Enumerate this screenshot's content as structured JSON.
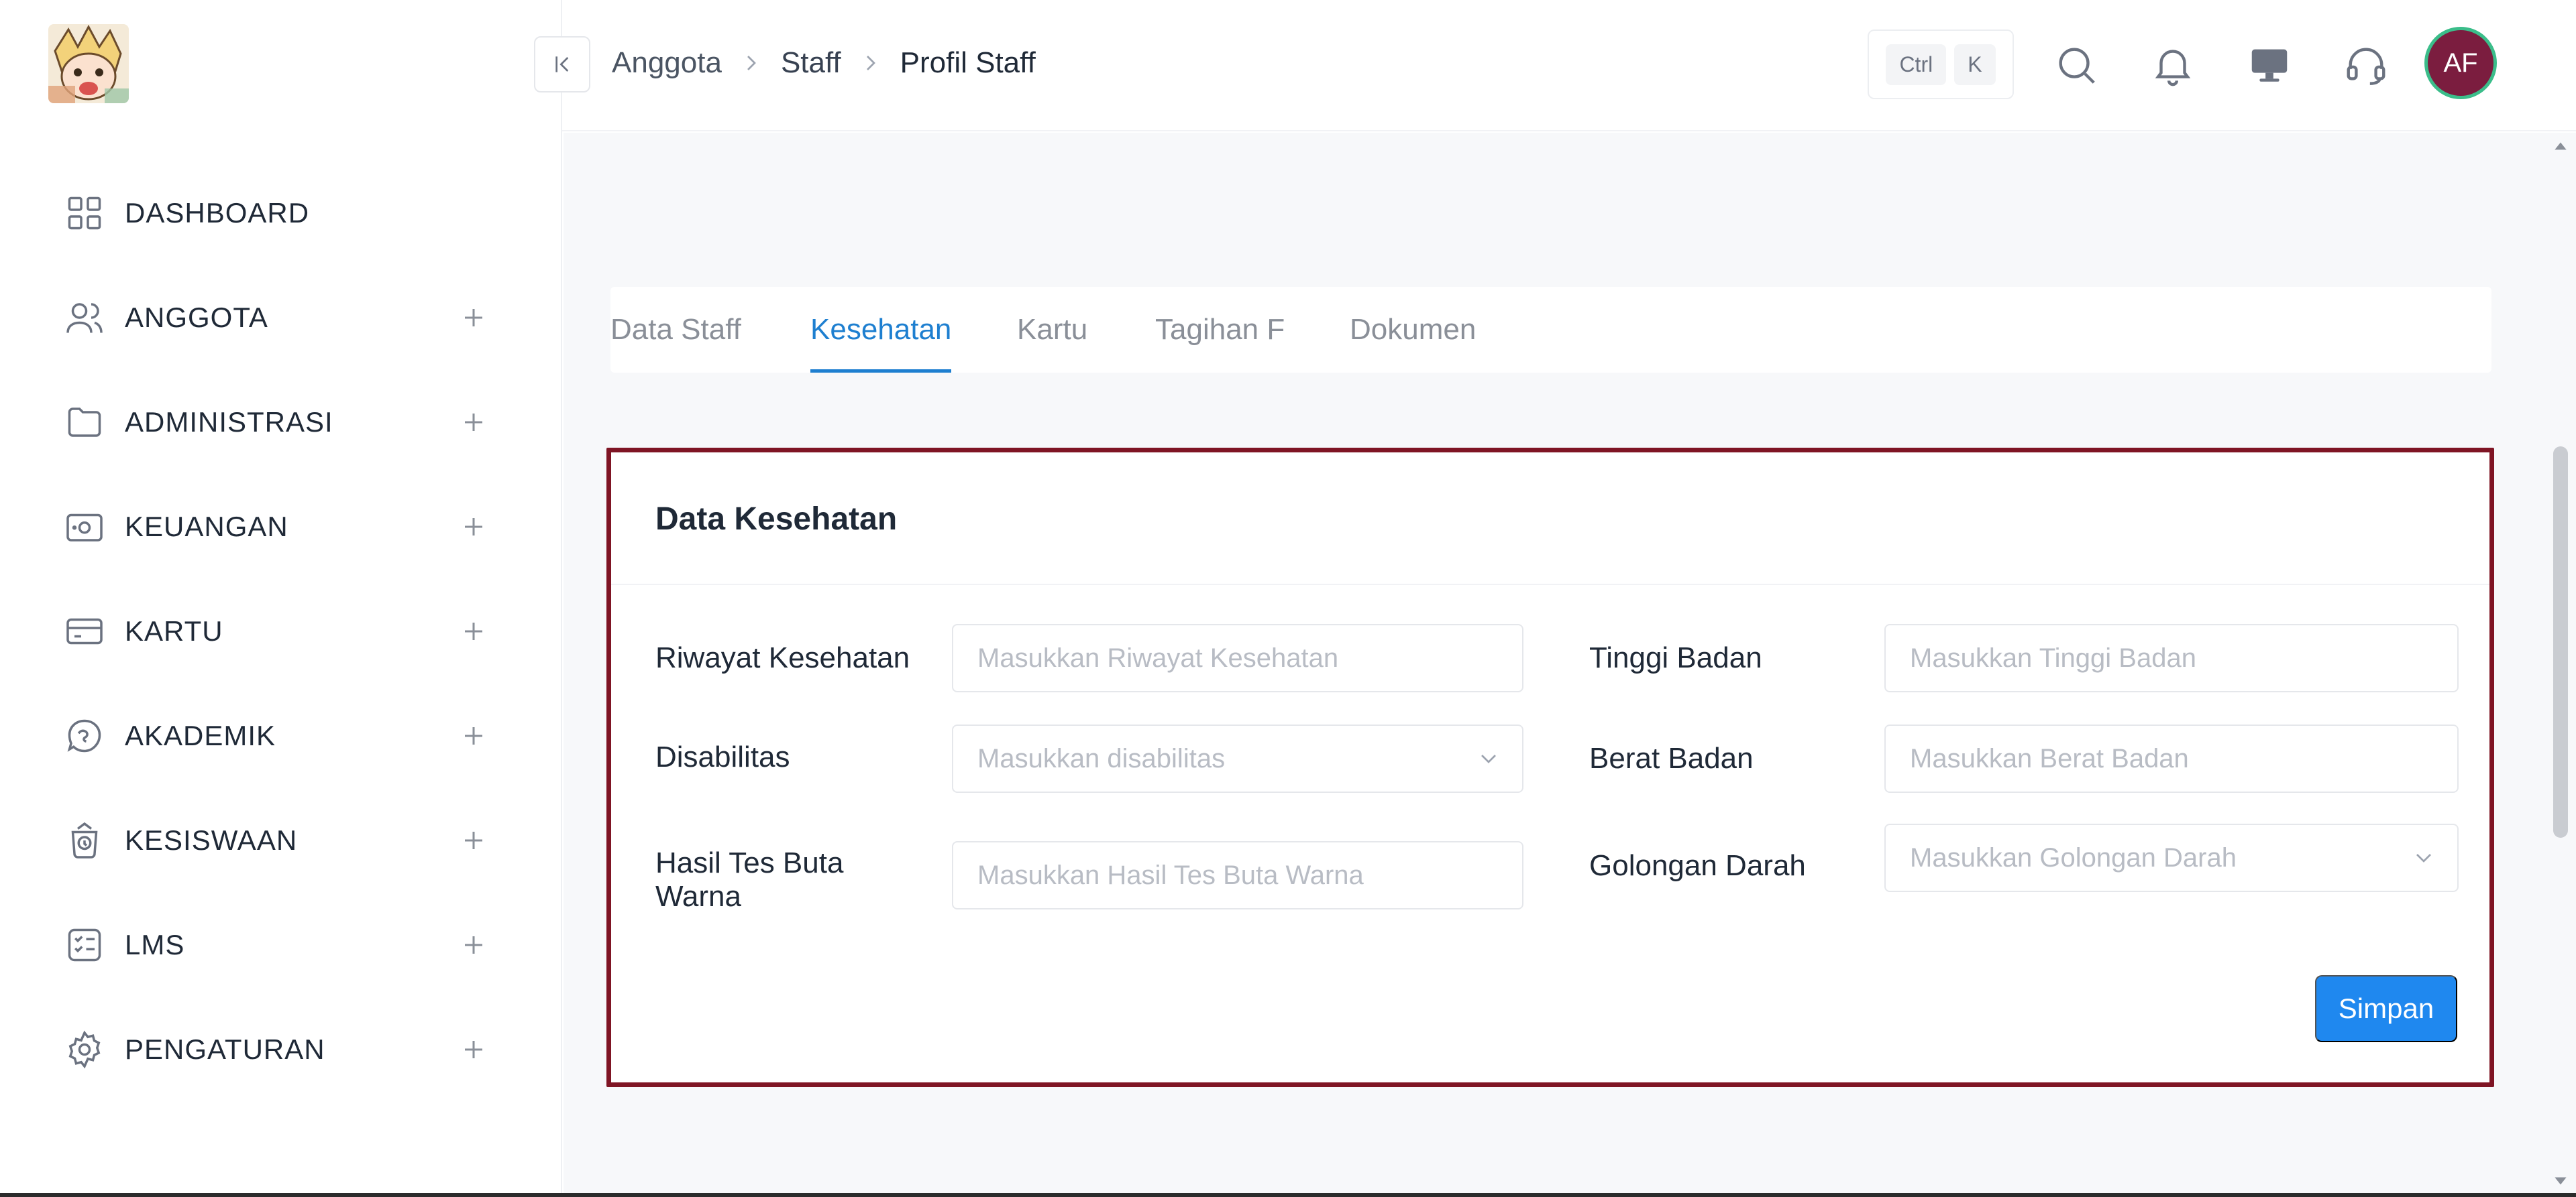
{
  "colors": {
    "accent": "#1e7fd0",
    "primary_button": "#1f88ef",
    "highlight_border": "#7f1524",
    "avatar_bg": "#7b1d3f",
    "avatar_ring": "#3bbd8a"
  },
  "sidebar": {
    "logo_icon": "anime-avatar-logo",
    "items": [
      {
        "label": "DASHBOARD",
        "icon": "grid-icon",
        "expandable": false
      },
      {
        "label": "ANGGOTA",
        "icon": "users-icon",
        "expandable": true
      },
      {
        "label": "ADMINISTRASI",
        "icon": "folder-icon",
        "expandable": true
      },
      {
        "label": "KEUANGAN",
        "icon": "wallet-icon",
        "expandable": true
      },
      {
        "label": "KARTU",
        "icon": "card-icon",
        "expandable": true
      },
      {
        "label": "AKADEMIK",
        "icon": "academic-icon",
        "expandable": true
      },
      {
        "label": "KESISWAAN",
        "icon": "student-icon",
        "expandable": true
      },
      {
        "label": "LMS",
        "icon": "checklist-icon",
        "expandable": true
      },
      {
        "label": "PENGATURAN",
        "icon": "settings-icon",
        "expandable": true
      }
    ]
  },
  "header": {
    "breadcrumb": [
      "Anggota",
      "Staff",
      "Profil Staff"
    ],
    "shortcut": {
      "ctrl": "Ctrl",
      "key": "K"
    },
    "icons": [
      "search-icon",
      "bell-icon",
      "monitor-icon",
      "headset-icon"
    ],
    "avatar_initials": "AF"
  },
  "tabs": [
    {
      "label": "Data Staff",
      "active": false
    },
    {
      "label": "Kesehatan",
      "active": true
    },
    {
      "label": "Kartu",
      "active": false
    },
    {
      "label": "Tagihan F",
      "active": false
    },
    {
      "label": "Dokumen",
      "active": false
    }
  ],
  "form": {
    "title": "Data Kesehatan",
    "fields": {
      "riwayat": {
        "label": "Riwayat Kesehatan",
        "placeholder": "Masukkan Riwayat Kesehatan",
        "value": ""
      },
      "disabilitas": {
        "label": "Disabilitas",
        "placeholder": "Masukkan disabilitas",
        "value": ""
      },
      "buta_warna": {
        "label": "Hasil Tes Buta Warna",
        "placeholder": "Masukkan Hasil Tes Buta Warna",
        "value": ""
      },
      "tinggi": {
        "label": "Tinggi Badan",
        "placeholder": "Masukkan Tinggi Badan",
        "value": ""
      },
      "berat": {
        "label": "Berat Badan",
        "placeholder": "Masukkan Berat Badan",
        "value": ""
      },
      "golongan": {
        "label": "Golongan Darah",
        "placeholder": "Masukkan Golongan Darah",
        "value": ""
      }
    },
    "submit_label": "Simpan"
  }
}
